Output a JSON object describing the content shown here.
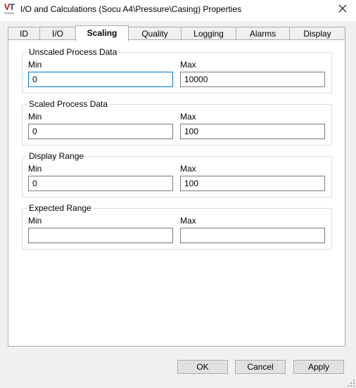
{
  "window": {
    "title": "I/O and Calculations (Socu A4\\Pressure\\Casing) Properties",
    "logo_text_v": "V",
    "logo_text_t": "T",
    "logo_subtext": "SCADA"
  },
  "tabs": [
    {
      "label": "ID"
    },
    {
      "label": "I/O"
    },
    {
      "label": "Scaling",
      "active": true
    },
    {
      "label": "Quality"
    },
    {
      "label": "Logging"
    },
    {
      "label": "Alarms"
    },
    {
      "label": "Display"
    }
  ],
  "groups": {
    "unscaled": {
      "title": "Unscaled Process Data",
      "min_label": "Min",
      "max_label": "Max",
      "min_value": "0",
      "max_value": "10000"
    },
    "scaled": {
      "title": "Scaled Process Data",
      "min_label": "Min",
      "max_label": "Max",
      "min_value": "0",
      "max_value": "100"
    },
    "display": {
      "title": "Display Range",
      "min_label": "Min",
      "max_label": "Max",
      "min_value": "0",
      "max_value": "100"
    },
    "expected": {
      "title": "Expected Range",
      "min_label": "Min",
      "max_label": "Max",
      "min_value": "",
      "max_value": ""
    }
  },
  "buttons": {
    "ok": "OK",
    "cancel": "Cancel",
    "apply": "Apply"
  },
  "icons": {
    "close": "close-icon",
    "grip": "resize-grip-icon",
    "logo": "app-logo-icon"
  },
  "colors": {
    "focus_border": "#0078d7",
    "logo_red": "#c00000",
    "logo_blue": "#1f3c88"
  }
}
